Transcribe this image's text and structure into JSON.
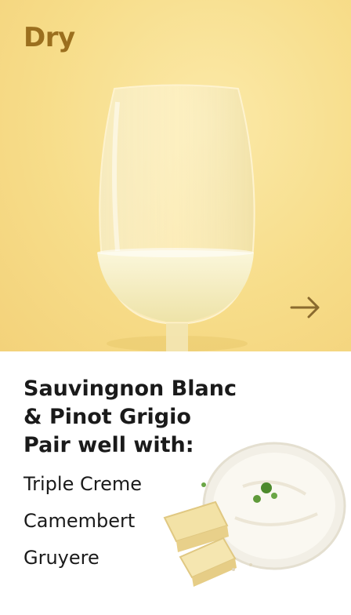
{
  "hero": {
    "category": "Dry",
    "next_icon": "arrow-right-icon",
    "colors": {
      "background": "#f7dd8a",
      "category_text": "#9b6f1e",
      "arrow": "#8a6a2e"
    }
  },
  "pairing": {
    "headline_lines": [
      "Sauvingnon Blanc",
      "& Pinot Grigio",
      "Pair well with:"
    ],
    "cheeses": [
      "Triple Creme",
      "Camembert",
      "Gruyere"
    ]
  }
}
